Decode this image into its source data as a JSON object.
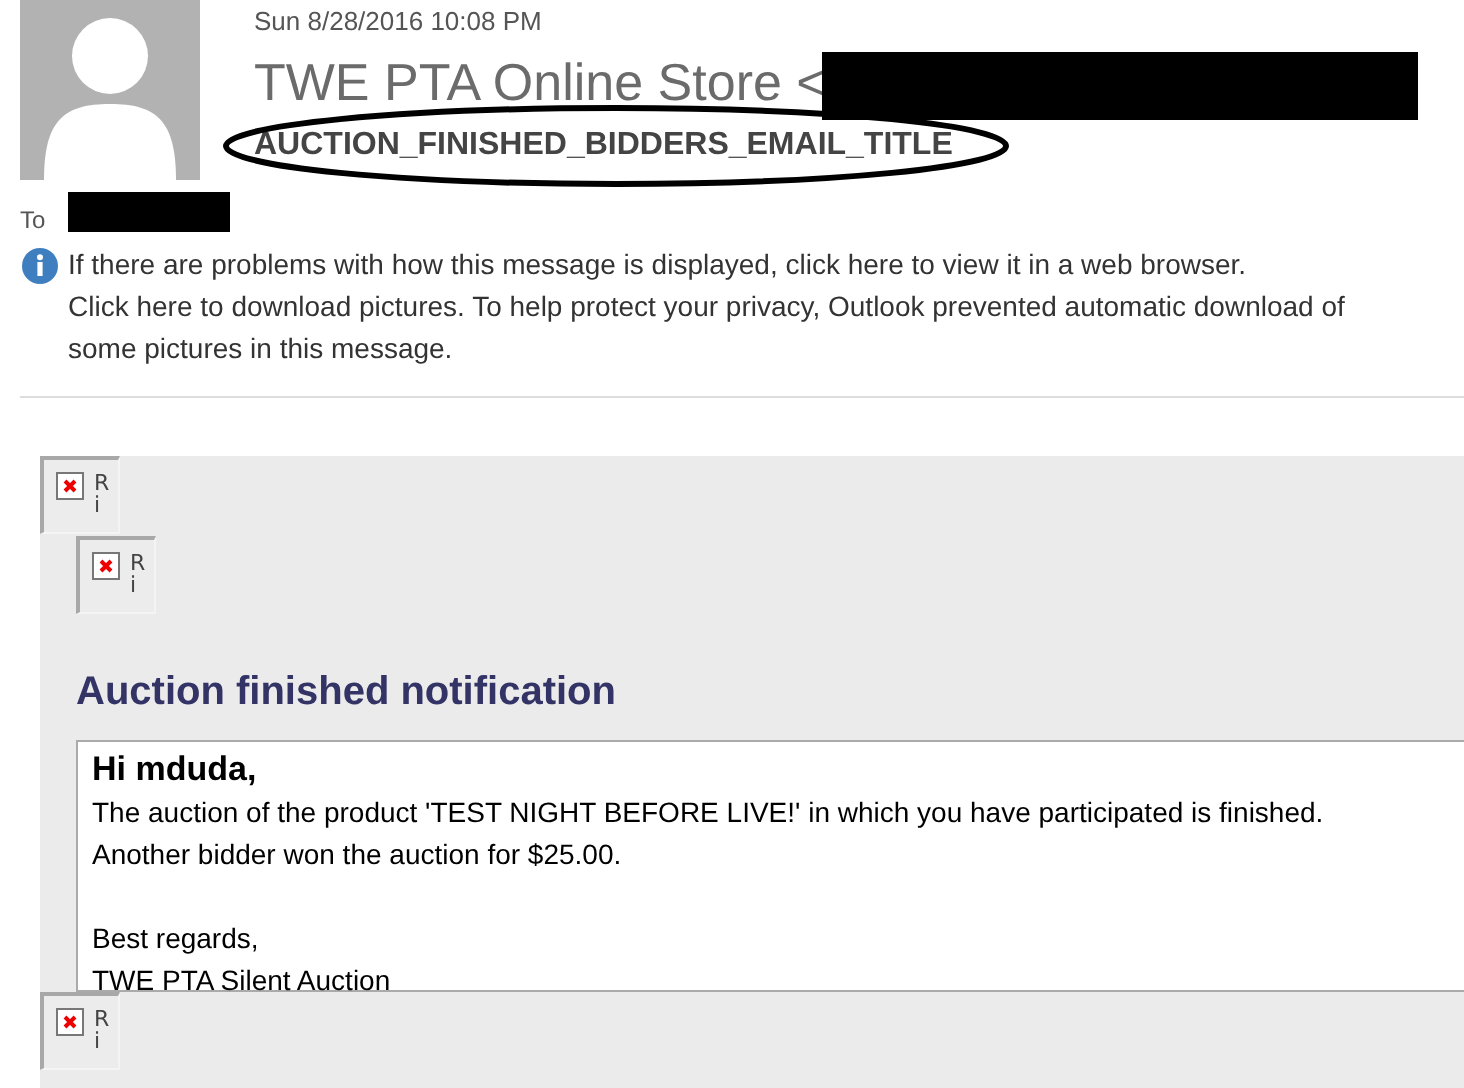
{
  "message": {
    "date": "Sun 8/28/2016 10:08 PM",
    "sender": "TWE PTA Online Store <",
    "subject": "AUCTION_FINISHED_BIDDERS_EMAIL_TITLE",
    "subject_circled": true,
    "to_label": "To"
  },
  "infobar": {
    "notice": "If there are problems with how this message is displayed, click here to view it in a web browser.",
    "download_notice": [
      "Click here to download pictures. To help protect your privacy, Outlook prevented automatic download of",
      "some pictures in this message."
    ]
  },
  "body": {
    "top_images": [
      {
        "alt": [
          "R",
          "i"
        ]
      },
      {
        "alt": [
          "R",
          "i"
        ]
      }
    ],
    "heading": "Auction finished notification",
    "greeting": "Hi mduda,",
    "paragraphs": [
      [
        "The auction of the product 'TEST NIGHT BEFORE LIVE!' in which you have participated is finished.",
        "Another bidder won the auction for $25.00."
      ],
      [
        "Best regards,",
        "TWE PTA Silent Auction"
      ]
    ],
    "bottom_image": {
      "alt": [
        "R",
        "i"
      ]
    }
  }
}
